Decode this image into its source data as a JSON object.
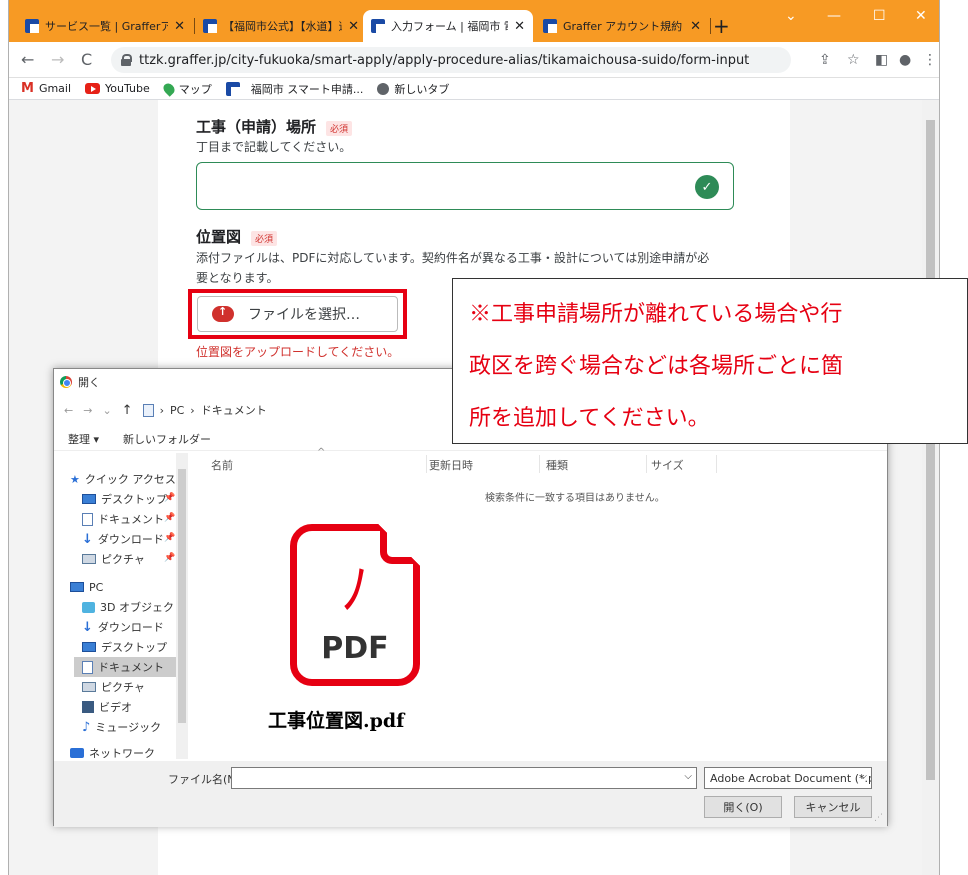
{
  "browser": {
    "tabs": [
      {
        "title": "サービス一覧 | Grafferアカウ"
      },
      {
        "title": "【福岡市公式】【水道】道路"
      },
      {
        "title": "入力フォーム | 福岡市 電子"
      },
      {
        "title": "Graffer アカウント規約 | G"
      }
    ],
    "new_tab": "+",
    "url": "ttzk.graffer.jp/city-fukuoka/smart-apply/apply-procedure-alias/tikamaichousa-suido/form-input",
    "bookmarks": [
      {
        "label": "Gmail"
      },
      {
        "label": "YouTube"
      },
      {
        "label": "マップ"
      },
      {
        "label": "福岡市 スマート申請..."
      },
      {
        "label": "新しいタブ"
      }
    ]
  },
  "form": {
    "location_label": "工事（申請）場所",
    "required_badge": "必須",
    "location_help": "丁目まで記載してください。",
    "location_value": "",
    "map_label": "位置図",
    "map_help_line1": "添付ファイルは、PDFに対応しています。契約件名が異なる工事・設計については別途申請が必",
    "map_help_line2": "要となります。",
    "file_button": "ファイルを選択…",
    "upload_message": "位置図をアップロードしてください。"
  },
  "callout": {
    "line1": "※工事申請場所が離れている場合や行",
    "line2": "政区を跨ぐ場合などは各場所ごとに箇",
    "line3": "所を追加してください。"
  },
  "dialog": {
    "title": "開く",
    "path": [
      "PC",
      "ドキュメント"
    ],
    "organize": "整理 ▾",
    "new_folder": "新しいフォルダー",
    "tree": [
      {
        "label": "クイック アクセス"
      },
      {
        "label": "デスクトップ"
      },
      {
        "label": "ドキュメント"
      },
      {
        "label": "ダウンロード"
      },
      {
        "label": "ピクチャ"
      },
      {
        "label": "PC"
      },
      {
        "label": "3D オブジェクト"
      },
      {
        "label": "ダウンロード"
      },
      {
        "label": "デスクトップ"
      },
      {
        "label": "ドキュメント"
      },
      {
        "label": "ピクチャ"
      },
      {
        "label": "ビデオ"
      },
      {
        "label": "ミュージック"
      },
      {
        "label": "ネットワーク"
      }
    ],
    "columns": [
      "名前",
      "更新日時",
      "種類",
      "サイズ"
    ],
    "empty_message": "検索条件に一致する項目はありません。",
    "filename_label": "ファイル名(N):",
    "filename_value": "",
    "filetype": "Adobe Acrobat Document (*.pc",
    "open_button": "開く(O)",
    "cancel_button": "キャンセル"
  },
  "pdf_overlay": {
    "icon_text": "PDF",
    "filename": "工事位置図.pdf"
  },
  "colors": {
    "tab_strip": "#f79a24",
    "highlight": "#e60012",
    "success": "#2e8b57"
  }
}
